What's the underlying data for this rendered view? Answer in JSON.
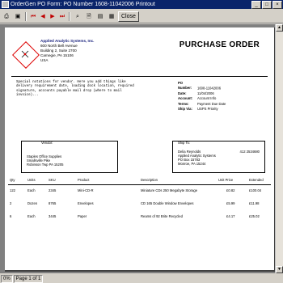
{
  "window": {
    "title": "OrderGen PO Form: PO Number 1608-11042006 Printout",
    "controls": {
      "minimize": "_",
      "maximize": "□",
      "close": "×"
    }
  },
  "toolbar": {
    "close_label": "Close",
    "icons": [
      "print-icon",
      "first-page-icon",
      "prev-page-icon",
      "next-page-icon",
      "last-page-icon",
      "find-icon",
      "export-icon",
      "zoom-icon"
    ]
  },
  "document": {
    "company": {
      "name": "Applied Analytic Systems, Inc.",
      "address1": "600 North Bell Avenue",
      "address2": "Building 2, Suite 2700",
      "city": "Carnegie, PA 15106",
      "country": "USA"
    },
    "title": "PURCHASE ORDER",
    "instructions": "Special notations for vendor. Here you add things like delivery requirement date, loading dock location, required signature, accounts payable mail drop (where to mail invoice)...",
    "fields": [
      {
        "label": "PO Number:",
        "value": "1608-11042006"
      },
      {
        "label": "Date:",
        "value": "11/04/2006"
      },
      {
        "label": "Account:",
        "value": "Account Info"
      },
      {
        "label": "Terms:",
        "value": "Payment Due Date"
      },
      {
        "label": "Ship Via:",
        "value": "USPS Priority"
      }
    ],
    "vendor": {
      "label": "Vendor:",
      "lines": [
        "Staples Office Supplies",
        "Smallsville Pike",
        "Robinson Twp PA 15205"
      ]
    },
    "ship_to": {
      "label": "Ship To:",
      "name": "Delia Reynolds",
      "phone": "412 2534680",
      "lines": [
        "Applied Analytic Systems",
        "PO Box 15783",
        "Monroe, PA 15244"
      ]
    },
    "columns": [
      "Qty",
      "Units",
      "SKU",
      "Product",
      "Description",
      "Unit Price",
      "Extended"
    ],
    "rows": [
      {
        "qty": "122",
        "units": "Each",
        "sku": "2345",
        "product": "Mini-CD-R",
        "description": "Miniature CDs 250 Megabyte Storage",
        "unit_price": "£0.82",
        "extended": "£100.04"
      },
      {
        "qty": "2",
        "units": "Dozen",
        "sku": "8765",
        "product": "Envelopes",
        "description": "CD 165 Double Window Envelopes",
        "unit_price": "£5.99",
        "extended": "£11.98"
      },
      {
        "qty": "6",
        "units": "Each",
        "sku": "3445",
        "product": "Paper",
        "description": "Reams of 92 Brite Recycled",
        "unit_price": "£4.17",
        "extended": "£25.02"
      }
    ]
  },
  "status": {
    "zoom": "0%",
    "page": "Page 1 of 1"
  }
}
